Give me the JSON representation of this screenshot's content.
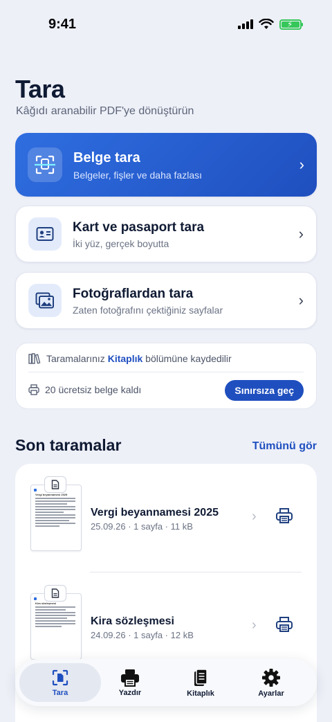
{
  "status_bar": {
    "time": "9:41"
  },
  "header": {
    "title": "Tara",
    "subtitle": "Kâğıdı aranabilir PDF'ye dönüştürün"
  },
  "scan_options": [
    {
      "title": "Belge tara",
      "subtitle": "Belgeler, fişler ve daha fazlası",
      "icon": "document-scan-icon"
    },
    {
      "title": "Kart ve pasaport tara",
      "subtitle": "İki yüz, gerçek boyutta",
      "icon": "id-card-icon"
    },
    {
      "title": "Fotoğraflardan tara",
      "subtitle": "Zaten fotoğrafını çektiğiniz sayfalar",
      "icon": "photos-icon"
    }
  ],
  "info": {
    "library_prefix": "Taramalarınız",
    "library_link": "Kitaplık",
    "library_suffix": "bölümüne kaydedilir",
    "free_docs": "20 ücretsiz belge kaldı",
    "upgrade_label": "Sınırsıza geç"
  },
  "recent": {
    "title": "Son taramalar",
    "see_all": "Tümünü gör",
    "items": [
      {
        "name": "Vergi beyannamesi 2025",
        "meta": "25.09.26 · 1 sayfa · 11 kB",
        "thumb_title": "Vergi beyannamesi 2025"
      },
      {
        "name": "Kira sözleşmesi",
        "meta": "24.09.26 · 1 sayfa · 12 kB",
        "thumb_title": "Kira sözleşmesi"
      }
    ]
  },
  "tabs": [
    {
      "label": "Tara",
      "icon": "scan-tab-icon",
      "active": true
    },
    {
      "label": "Yazdır",
      "icon": "printer-icon",
      "active": false
    },
    {
      "label": "Kitaplık",
      "icon": "library-icon",
      "active": false
    },
    {
      "label": "Ayarlar",
      "icon": "gear-icon",
      "active": false
    }
  ],
  "colors": {
    "accent": "#1f4fbf",
    "background": "#eef0f8"
  }
}
